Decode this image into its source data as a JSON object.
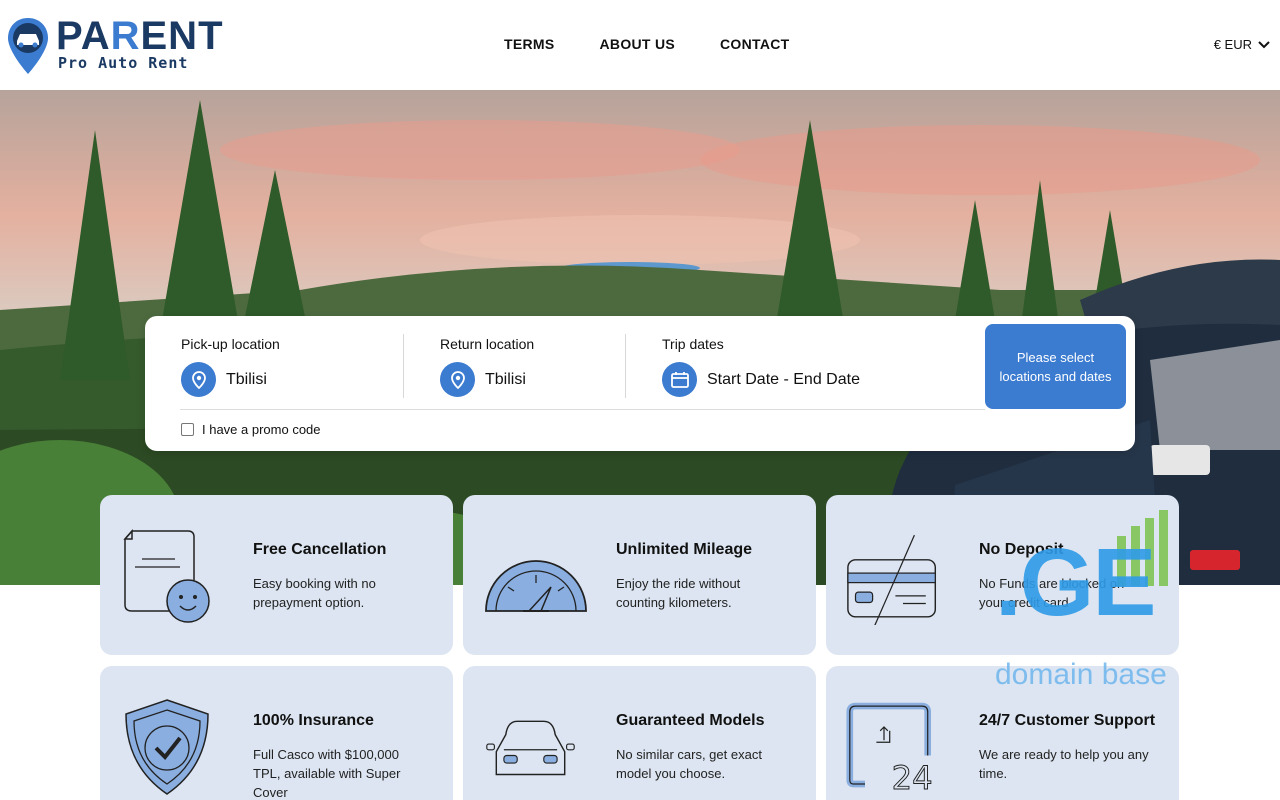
{
  "logo": {
    "word_a": "PA",
    "word_accent": "R",
    "word_b": "ENT",
    "subtitle": "Pro Auto Rent"
  },
  "nav": {
    "terms": "TERMS",
    "about": "ABOUT US",
    "contact": "CONTACT"
  },
  "currency": {
    "label": "€ EUR"
  },
  "search": {
    "pickup": {
      "label": "Pick-up location",
      "value": "Tbilisi"
    },
    "return": {
      "label": "Return location",
      "value": "Tbilisi"
    },
    "dates": {
      "label": "Trip dates",
      "value": "Start Date - End Date"
    },
    "promo_label": "I have a promo code",
    "submit_label": "Please select locations and dates"
  },
  "features": [
    {
      "title": "Free Cancellation",
      "desc": "Easy booking with no prepayment option."
    },
    {
      "title": "Unlimited Mileage",
      "desc": "Enjoy the ride without counting kilometers."
    },
    {
      "title": "No Deposit",
      "desc": "No Funds are blocked on your credit card"
    },
    {
      "title": "100% Insurance",
      "desc": "Full Casco with $100,000 TPL, available with Super Cover"
    },
    {
      "title": "Guaranteed Models",
      "desc": "No similar cars, get exact model you choose."
    },
    {
      "title": "24/7 Customer Support",
      "desc": "We are ready to help you any time."
    }
  ],
  "watermark": {
    "brand": ".GE",
    "tagline": "domain base"
  },
  "colors": {
    "brand_blue": "#3b7bd0",
    "navy": "#1b3a63",
    "card_bg": "#dce5f1"
  }
}
